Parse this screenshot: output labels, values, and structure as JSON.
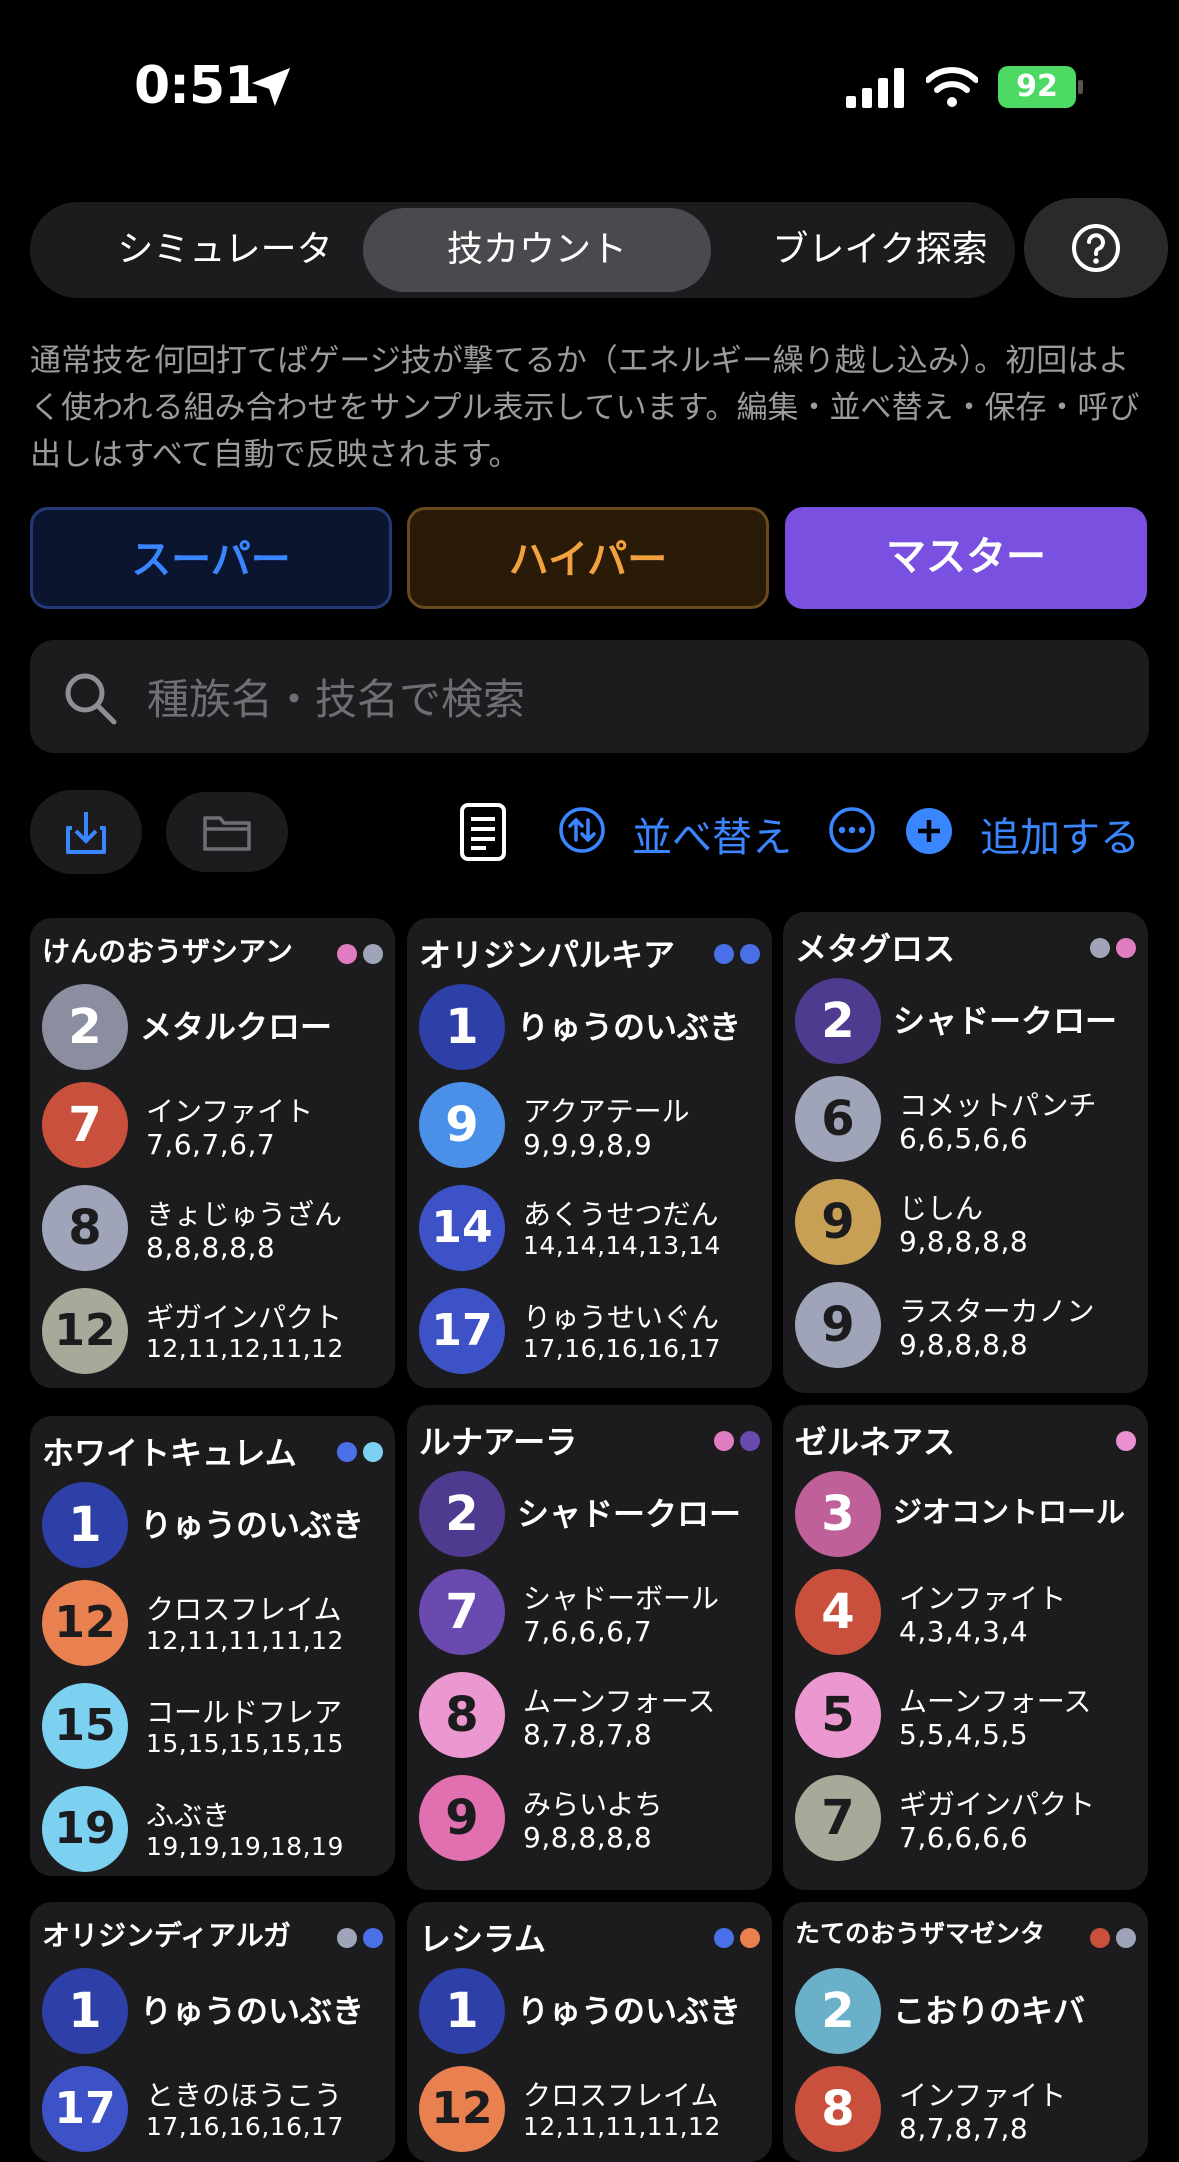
{
  "status_bar": {
    "time": "0:51",
    "battery": "92"
  },
  "segments": [
    "シミュレータ",
    "技カウント",
    "ブレイク探索"
  ],
  "description": "通常技を何回打てばゲージ技が撃てるか（エネルギー繰り越し込み）。初回はよく使われる組み合わせをサンプル表示しています。編集・並べ替え・保存・呼び出しはすべて自動で反映されます。",
  "tiers": {
    "super": "スーパー",
    "hyper": "ハイパー",
    "master": "マスター"
  },
  "search": {
    "placeholder": "種族名・技名で検索"
  },
  "toolbar": {
    "sort_label": "並べ替え",
    "add_label": "追加する"
  },
  "colors": {
    "accent": "#3a86ff",
    "master": "#7a50e0"
  },
  "cards": [
    {
      "name": "けんのおうザシアン",
      "dots": [
        "#e07cc0",
        "#a0a4b8"
      ],
      "fast": {
        "count": "2",
        "name": "メタルクロー",
        "color": "#8a8e9e"
      },
      "charged": [
        {
          "count": "7",
          "name": "インファイト",
          "seq": "7,6,7,6,7",
          "color": "#c8503c"
        },
        {
          "count": "8",
          "name": "きょじゅうざん",
          "seq": "8,8,8,8,8",
          "color": "#a0a4b8"
        },
        {
          "count": "12",
          "name": "ギガインパクト",
          "seq": "12,11,12,11,12",
          "color": "#a9a99a"
        }
      ]
    },
    {
      "name": "オリジンパルキア",
      "dots": [
        "#4a70e8",
        "#4a70e8"
      ],
      "fast": {
        "count": "1",
        "name": "りゅうのいぶき",
        "color": "#2e3fa8"
      },
      "charged": [
        {
          "count": "9",
          "name": "アクアテール",
          "seq": "9,9,9,8,9",
          "color": "#4a90e8"
        },
        {
          "count": "14",
          "name": "あくうせつだん",
          "seq": "14,14,14,13,14",
          "color": "#3e52c8"
        },
        {
          "count": "17",
          "name": "りゅうせいぐん",
          "seq": "17,16,16,16,17",
          "color": "#3e52c8"
        }
      ]
    },
    {
      "name": "メタグロス",
      "dots": [
        "#a0a4b8",
        "#e07cc0"
      ],
      "fast": {
        "count": "2",
        "name": "シャドークロー",
        "color": "#4e3a8e"
      },
      "charged": [
        {
          "count": "6",
          "name": "コメットパンチ",
          "seq": "6,6,5,6,6",
          "color": "#a0a4b8"
        },
        {
          "count": "9",
          "name": "じしん",
          "seq": "9,8,8,8,8",
          "color": "#c8a055"
        },
        {
          "count": "9",
          "name": "ラスターカノン",
          "seq": "9,8,8,8,8",
          "color": "#a0a4b8"
        }
      ]
    },
    {
      "name": "ホワイトキュレム",
      "dots": [
        "#4a70e8",
        "#7cd0f0"
      ],
      "fast": {
        "count": "1",
        "name": "りゅうのいぶき",
        "color": "#2e3fa8"
      },
      "charged": [
        {
          "count": "12",
          "name": "クロスフレイム",
          "seq": "12,11,11,11,12",
          "color": "#e88050"
        },
        {
          "count": "15",
          "name": "コールドフレア",
          "seq": "15,15,15,15,15",
          "color": "#7cd0f0"
        },
        {
          "count": "19",
          "name": "ふぶき",
          "seq": "19,19,19,18,19",
          "color": "#7cd0f0"
        }
      ]
    },
    {
      "name": "ルナアーラ",
      "dots": [
        "#e07cc0",
        "#6a4aae"
      ],
      "fast": {
        "count": "2",
        "name": "シャドークロー",
        "color": "#4e3a8e"
      },
      "charged": [
        {
          "count": "7",
          "name": "シャドーボール",
          "seq": "7,6,6,6,7",
          "color": "#6a4aae"
        },
        {
          "count": "8",
          "name": "ムーンフォース",
          "seq": "8,7,8,7,8",
          "color": "#ec98d0"
        },
        {
          "count": "9",
          "name": "みらいよち",
          "seq": "9,8,8,8,8",
          "color": "#e070b0"
        }
      ]
    },
    {
      "name": "ゼルネアス",
      "dots": [
        "#e890d0"
      ],
      "fast": {
        "count": "3",
        "name": "ジオコントロール",
        "color": "#c06098"
      },
      "charged": [
        {
          "count": "4",
          "name": "インファイト",
          "seq": "4,3,4,3,4",
          "color": "#c8503c"
        },
        {
          "count": "5",
          "name": "ムーンフォース",
          "seq": "5,5,4,5,5",
          "color": "#ec98d0"
        },
        {
          "count": "7",
          "name": "ギガインパクト",
          "seq": "7,6,6,6,6",
          "color": "#a9a99a"
        }
      ]
    },
    {
      "name": "オリジンディアルガ",
      "dots": [
        "#a0a4b8",
        "#4a70e8"
      ],
      "fast": {
        "count": "1",
        "name": "りゅうのいぶき",
        "color": "#2e3fa8"
      },
      "charged": [
        {
          "count": "17",
          "name": "ときのほうこう",
          "seq": "17,16,16,16,17",
          "color": "#3e52c8"
        }
      ]
    },
    {
      "name": "レシラム",
      "dots": [
        "#4a70e8",
        "#e88050"
      ],
      "fast": {
        "count": "1",
        "name": "りゅうのいぶき",
        "color": "#2e3fa8"
      },
      "charged": [
        {
          "count": "12",
          "name": "クロスフレイム",
          "seq": "12,11,11,11,12",
          "color": "#e88050"
        }
      ]
    },
    {
      "name": "たてのおうザマゼンタ",
      "dots": [
        "#c8503c",
        "#a0a4b8"
      ],
      "fast": {
        "count": "2",
        "name": "こおりのキバ",
        "color": "#6ab0c8"
      },
      "charged": [
        {
          "count": "8",
          "name": "インファイト",
          "seq": "8,7,8,7,8",
          "color": "#c8503c"
        }
      ]
    }
  ]
}
